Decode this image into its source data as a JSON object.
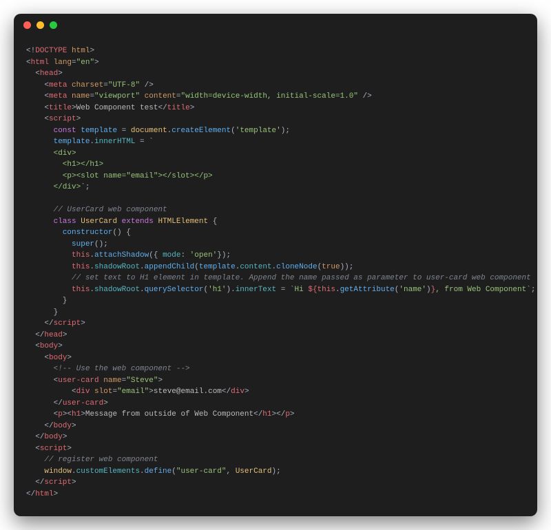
{
  "code": {
    "lines": [
      [
        [
          "t-punct",
          "<!"
        ],
        [
          "t-tag",
          "DOCTYPE"
        ],
        [
          "t-punct",
          " "
        ],
        [
          "t-attr",
          "html"
        ],
        [
          "t-punct",
          ">"
        ]
      ],
      [
        [
          "t-punct",
          "<"
        ],
        [
          "t-tag",
          "html"
        ],
        [
          "t-punct",
          " "
        ],
        [
          "t-attr",
          "lang"
        ],
        [
          "t-punct",
          "="
        ],
        [
          "t-string",
          "\"en\""
        ],
        [
          "t-punct",
          ">"
        ]
      ],
      [
        [
          "t-punct",
          "  <"
        ],
        [
          "t-tag",
          "head"
        ],
        [
          "t-punct",
          ">"
        ]
      ],
      [
        [
          "t-punct",
          "    <"
        ],
        [
          "t-tag",
          "meta"
        ],
        [
          "t-punct",
          " "
        ],
        [
          "t-attr",
          "charset"
        ],
        [
          "t-punct",
          "="
        ],
        [
          "t-string",
          "\"UTF-8\""
        ],
        [
          "t-punct",
          " />"
        ]
      ],
      [
        [
          "t-punct",
          "    <"
        ],
        [
          "t-tag",
          "meta"
        ],
        [
          "t-punct",
          " "
        ],
        [
          "t-attr",
          "name"
        ],
        [
          "t-punct",
          "="
        ],
        [
          "t-string",
          "\"viewport\""
        ],
        [
          "t-punct",
          " "
        ],
        [
          "t-attr",
          "content"
        ],
        [
          "t-punct",
          "="
        ],
        [
          "t-string",
          "\"width=device-width, initial-scale=1.0\""
        ],
        [
          "t-punct",
          " />"
        ]
      ],
      [
        [
          "t-punct",
          "    <"
        ],
        [
          "t-tag",
          "title"
        ],
        [
          "t-punct",
          ">"
        ],
        [
          "t-text",
          "Web Component test"
        ],
        [
          "t-punct",
          "</"
        ],
        [
          "t-tag",
          "title"
        ],
        [
          "t-punct",
          ">"
        ]
      ],
      [
        [
          "t-punct",
          "    <"
        ],
        [
          "t-tag",
          "script"
        ],
        [
          "t-punct",
          ">"
        ]
      ],
      [
        [
          "t-punct",
          "      "
        ],
        [
          "t-keyword",
          "const"
        ],
        [
          "t-punct",
          " "
        ],
        [
          "t-varblue",
          "template"
        ],
        [
          "t-punct",
          " = "
        ],
        [
          "t-class",
          "document"
        ],
        [
          "t-punct",
          "."
        ],
        [
          "t-func",
          "createElement"
        ],
        [
          "t-punct",
          "("
        ],
        [
          "t-string",
          "'template'"
        ],
        [
          "t-punct",
          ");"
        ]
      ],
      [
        [
          "t-punct",
          "      "
        ],
        [
          "t-varblue",
          "template"
        ],
        [
          "t-punct",
          "."
        ],
        [
          "t-prop",
          "innerHTML"
        ],
        [
          "t-punct",
          " = "
        ],
        [
          "t-string",
          "`"
        ]
      ],
      [
        [
          "t-string",
          "      <div>"
        ]
      ],
      [
        [
          "t-string",
          "        <h1></h1>"
        ]
      ],
      [
        [
          "t-string",
          "        <p><slot name=\"email\"></slot></p>"
        ]
      ],
      [
        [
          "t-string",
          "      </div>`"
        ],
        [
          "t-punct",
          ";"
        ]
      ],
      [
        [
          "t-punct",
          ""
        ]
      ],
      [
        [
          "t-punct",
          "      "
        ],
        [
          "t-comment",
          "// UserCard web component"
        ]
      ],
      [
        [
          "t-punct",
          "      "
        ],
        [
          "t-keyword",
          "class"
        ],
        [
          "t-punct",
          " "
        ],
        [
          "t-class",
          "UserCard"
        ],
        [
          "t-punct",
          " "
        ],
        [
          "t-keyword",
          "extends"
        ],
        [
          "t-punct",
          " "
        ],
        [
          "t-class",
          "HTMLElement"
        ],
        [
          "t-punct",
          " {"
        ]
      ],
      [
        [
          "t-punct",
          "        "
        ],
        [
          "t-func",
          "constructor"
        ],
        [
          "t-punct",
          "() {"
        ]
      ],
      [
        [
          "t-punct",
          "          "
        ],
        [
          "t-func",
          "super"
        ],
        [
          "t-punct",
          "();"
        ]
      ],
      [
        [
          "t-punct",
          "          "
        ],
        [
          "t-var",
          "this"
        ],
        [
          "t-punct",
          "."
        ],
        [
          "t-func",
          "attachShadow"
        ],
        [
          "t-punct",
          "({ "
        ],
        [
          "t-prop",
          "mode"
        ],
        [
          "t-punct",
          ": "
        ],
        [
          "t-string",
          "'open'"
        ],
        [
          "t-punct",
          "});"
        ]
      ],
      [
        [
          "t-punct",
          "          "
        ],
        [
          "t-var",
          "this"
        ],
        [
          "t-punct",
          "."
        ],
        [
          "t-prop",
          "shadowRoot"
        ],
        [
          "t-punct",
          "."
        ],
        [
          "t-func",
          "appendChild"
        ],
        [
          "t-punct",
          "("
        ],
        [
          "t-varblue",
          "template"
        ],
        [
          "t-punct",
          "."
        ],
        [
          "t-prop",
          "content"
        ],
        [
          "t-punct",
          "."
        ],
        [
          "t-func",
          "cloneNode"
        ],
        [
          "t-punct",
          "("
        ],
        [
          "t-const",
          "true"
        ],
        [
          "t-punct",
          "));"
        ]
      ],
      [
        [
          "t-punct",
          "          "
        ],
        [
          "t-comment",
          "// set text to H1 element in template. Append the name passed as parameter to user-card web component"
        ]
      ],
      [
        [
          "t-punct",
          "          "
        ],
        [
          "t-var",
          "this"
        ],
        [
          "t-punct",
          "."
        ],
        [
          "t-prop",
          "shadowRoot"
        ],
        [
          "t-punct",
          "."
        ],
        [
          "t-func",
          "querySelector"
        ],
        [
          "t-punct",
          "("
        ],
        [
          "t-string",
          "'h1'"
        ],
        [
          "t-punct",
          ")."
        ],
        [
          "t-prop",
          "innerText"
        ],
        [
          "t-punct",
          " = "
        ],
        [
          "t-string",
          "`Hi "
        ],
        [
          "t-interp",
          "${"
        ],
        [
          "t-var",
          "this"
        ],
        [
          "t-punct",
          "."
        ],
        [
          "t-func",
          "getAttribute"
        ],
        [
          "t-punct",
          "("
        ],
        [
          "t-string",
          "'name'"
        ],
        [
          "t-punct",
          ")"
        ],
        [
          "t-interp",
          "}"
        ],
        [
          "t-string",
          ", from Web Component`"
        ],
        [
          "t-punct",
          ";"
        ]
      ],
      [
        [
          "t-punct",
          "        }"
        ]
      ],
      [
        [
          "t-punct",
          "      }"
        ]
      ],
      [
        [
          "t-punct",
          "    </"
        ],
        [
          "t-tag",
          "script"
        ],
        [
          "t-punct",
          ">"
        ]
      ],
      [
        [
          "t-punct",
          "  </"
        ],
        [
          "t-tag",
          "head"
        ],
        [
          "t-punct",
          ">"
        ]
      ],
      [
        [
          "t-punct",
          "  <"
        ],
        [
          "t-tag",
          "body"
        ],
        [
          "t-punct",
          ">"
        ]
      ],
      [
        [
          "t-punct",
          "    <"
        ],
        [
          "t-tag",
          "body"
        ],
        [
          "t-punct",
          ">"
        ]
      ],
      [
        [
          "t-punct",
          "      "
        ],
        [
          "t-comment",
          "<!-- Use the web component -->"
        ]
      ],
      [
        [
          "t-punct",
          "      <"
        ],
        [
          "t-tag",
          "user-card"
        ],
        [
          "t-punct",
          " "
        ],
        [
          "t-attr",
          "name"
        ],
        [
          "t-punct",
          "="
        ],
        [
          "t-string",
          "\"Steve\""
        ],
        [
          "t-punct",
          ">"
        ]
      ],
      [
        [
          "t-punct",
          "          <"
        ],
        [
          "t-tag",
          "div"
        ],
        [
          "t-punct",
          " "
        ],
        [
          "t-attr",
          "slot"
        ],
        [
          "t-punct",
          "="
        ],
        [
          "t-string",
          "\"email\""
        ],
        [
          "t-punct",
          ">"
        ],
        [
          "t-text",
          "steve@email.com"
        ],
        [
          "t-punct",
          "</"
        ],
        [
          "t-tag",
          "div"
        ],
        [
          "t-punct",
          ">"
        ]
      ],
      [
        [
          "t-punct",
          "      </"
        ],
        [
          "t-tag",
          "user-card"
        ],
        [
          "t-punct",
          ">"
        ]
      ],
      [
        [
          "t-punct",
          "      <"
        ],
        [
          "t-tag",
          "p"
        ],
        [
          "t-punct",
          "><"
        ],
        [
          "t-tag",
          "h1"
        ],
        [
          "t-punct",
          ">"
        ],
        [
          "t-text",
          "Message from outside of Web Component"
        ],
        [
          "t-punct",
          "</"
        ],
        [
          "t-tag",
          "h1"
        ],
        [
          "t-punct",
          "></"
        ],
        [
          "t-tag",
          "p"
        ],
        [
          "t-punct",
          ">"
        ]
      ],
      [
        [
          "t-punct",
          "    </"
        ],
        [
          "t-tag",
          "body"
        ],
        [
          "t-punct",
          ">"
        ]
      ],
      [
        [
          "t-punct",
          "  </"
        ],
        [
          "t-tag",
          "body"
        ],
        [
          "t-punct",
          ">"
        ]
      ],
      [
        [
          "t-punct",
          "  <"
        ],
        [
          "t-tag",
          "script"
        ],
        [
          "t-punct",
          ">"
        ]
      ],
      [
        [
          "t-punct",
          "    "
        ],
        [
          "t-comment",
          "// register web component"
        ]
      ],
      [
        [
          "t-punct",
          "    "
        ],
        [
          "t-class",
          "window"
        ],
        [
          "t-punct",
          "."
        ],
        [
          "t-prop",
          "customElements"
        ],
        [
          "t-punct",
          "."
        ],
        [
          "t-func",
          "define"
        ],
        [
          "t-punct",
          "("
        ],
        [
          "t-string",
          "\"user-card\""
        ],
        [
          "t-punct",
          ", "
        ],
        [
          "t-class",
          "UserCard"
        ],
        [
          "t-punct",
          ");"
        ]
      ],
      [
        [
          "t-punct",
          "  </"
        ],
        [
          "t-tag",
          "script"
        ],
        [
          "t-punct",
          ">"
        ]
      ],
      [
        [
          "t-punct",
          "</"
        ],
        [
          "t-tag",
          "html"
        ],
        [
          "t-punct",
          ">"
        ]
      ]
    ]
  }
}
